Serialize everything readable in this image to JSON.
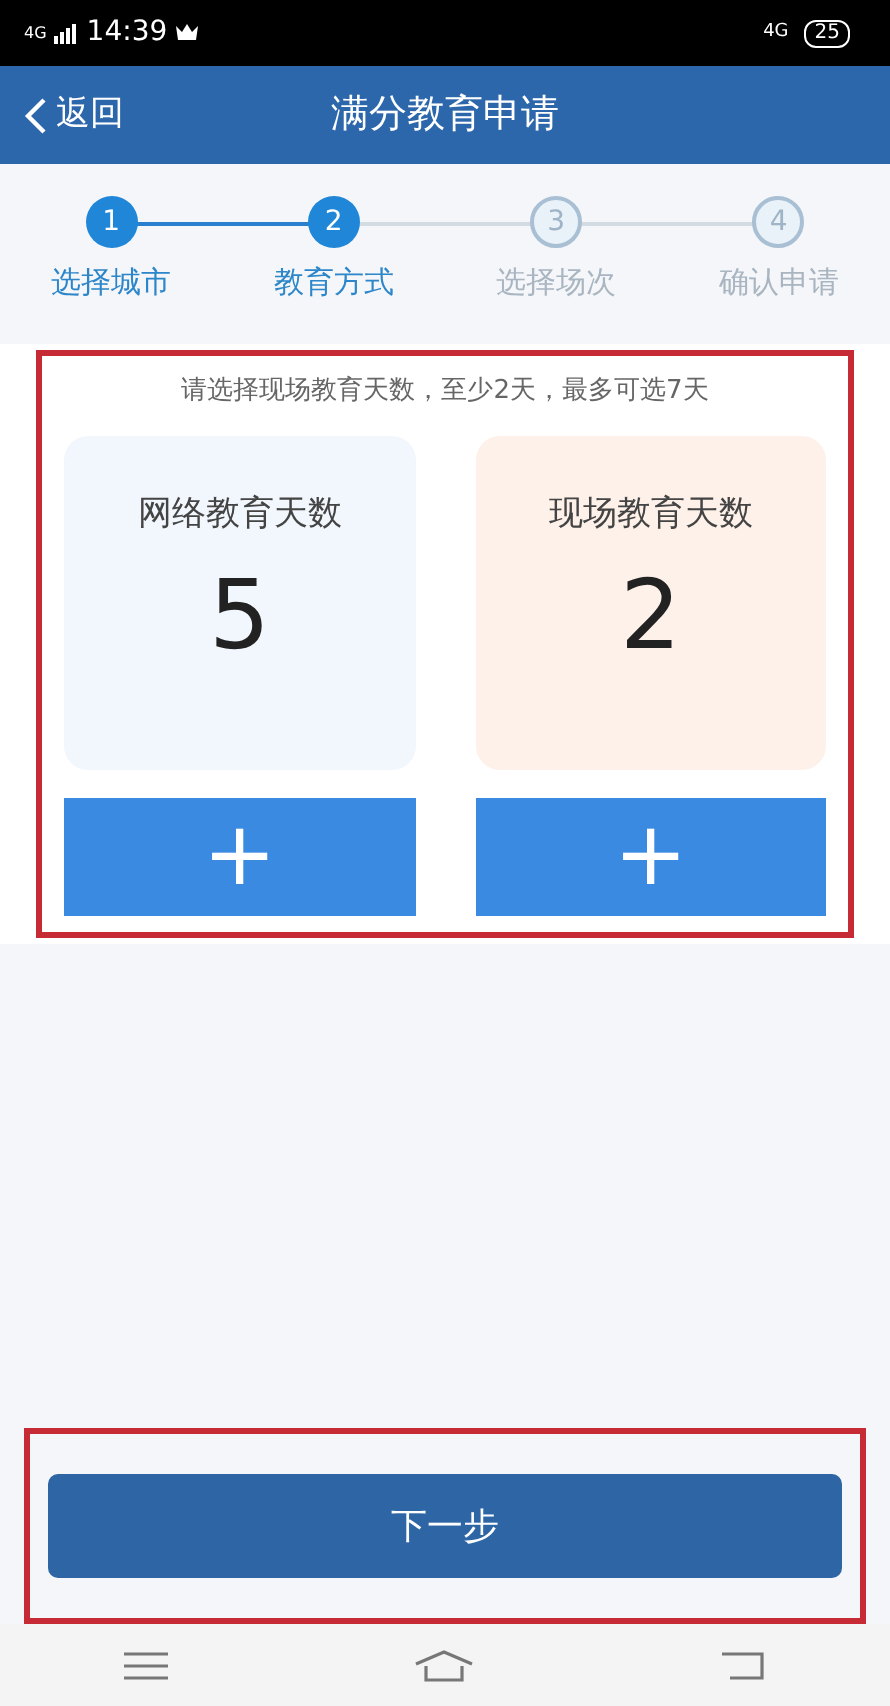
{
  "status_bar": {
    "network_left": "4G",
    "time": "14:39",
    "network_right": "4G",
    "battery": "25"
  },
  "header": {
    "back": "返回",
    "title": "满分教育申请"
  },
  "steps": [
    {
      "number": "1",
      "label": "选择城市",
      "completed": true
    },
    {
      "number": "2",
      "label": "教育方式",
      "completed": true
    },
    {
      "number": "3",
      "label": "选择场次",
      "completed": false
    },
    {
      "number": "4",
      "label": "确认申请",
      "completed": false
    }
  ],
  "hint": "请选择现场教育天数，至少2天，最多可选7天",
  "counters": [
    {
      "kind": "online",
      "label": "网络教育天数",
      "value": "5",
      "button": "+"
    },
    {
      "kind": "onsite",
      "label": "现场教育天数",
      "value": "2",
      "button": "+"
    }
  ],
  "next_button": "下一步"
}
